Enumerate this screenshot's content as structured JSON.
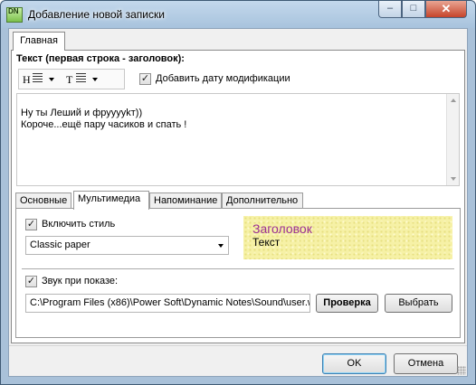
{
  "window": {
    "title": "Добавление новой записки",
    "icon_text": "DN",
    "icon": "dynamic-notes-app-icon",
    "buttons": {
      "minimize": "–",
      "maximize": "□",
      "close": "✕"
    }
  },
  "top_tabs": [
    {
      "label": "Главная",
      "active": true
    }
  ],
  "editor": {
    "label": "Текст (первая строка - заголовок):",
    "toolbar": {
      "heading": "H",
      "text": "T"
    },
    "add_date_checked": true,
    "add_date_label": "Добавить дату модификации",
    "note_text": "Ну ты Леший и фрууууkт))\nКороче...ещё пару часиков и спать !"
  },
  "sub_tabs": [
    {
      "label": "Основные",
      "active": false
    },
    {
      "label": "Мультимедиа",
      "active": true
    },
    {
      "label": "Напоминание",
      "active": false
    },
    {
      "label": "Дополнительно",
      "active": false
    }
  ],
  "multimedia": {
    "style_enabled": true,
    "style_label": "Включить стиль",
    "style_value": "Classic paper",
    "preview_heading": "Заголовок",
    "preview_text": "Текст",
    "preview_colors": {
      "background": "#f6f1a6",
      "heading": "#9b2f95"
    },
    "sound_enabled": true,
    "sound_label": "Звук при показе:",
    "sound_path": "C:\\Program Files (x86)\\Power Soft\\Dynamic Notes\\Sound\\user.w",
    "check_button": "Проверка",
    "browse_button": "Выбрать"
  },
  "dialog_buttons": {
    "ok": "OK",
    "cancel": "Отмена"
  },
  "check_mark": "✓"
}
